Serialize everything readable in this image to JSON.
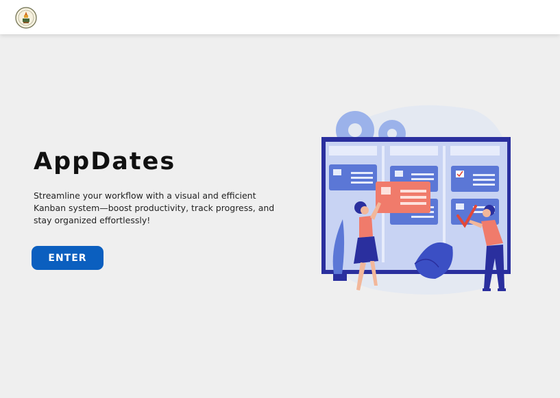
{
  "header": {
    "logo_icon": "institution-seal-logo"
  },
  "hero": {
    "title": "AppDates",
    "description": "Streamline your workflow with a visual and efficient Kanban system—boost productivity, track progress, and stay organized effortlessly!",
    "enter_label": "ENTER"
  },
  "illustration": {
    "name": "kanban-board-illustration",
    "colors": {
      "board_frame": "#2a2f9e",
      "board_bg": "#c8d3f3",
      "card_blue": "#5b77d6",
      "card_red": "#f07b6b",
      "gears": "#8ea7e6",
      "blob": "#e4e9f2"
    }
  },
  "colors": {
    "accent": "#0b5fbf",
    "background": "#efefef",
    "header_bg": "#ffffff"
  }
}
